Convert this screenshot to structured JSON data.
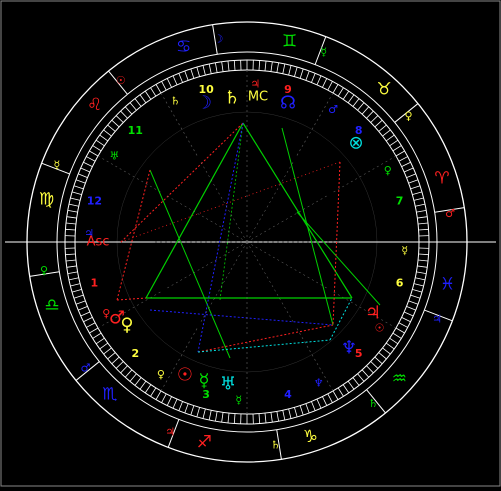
{
  "colors": {
    "background": "#000000",
    "frame": "#ffffff",
    "fire": "#ff2020",
    "earth": "#00e000",
    "air": "#ffff40",
    "water": "#2020ff",
    "aspect_trine": "#00d000",
    "aspect_square": "#ff2020",
    "aspect_sextile": "#2020ff",
    "aspect_quincunx": "#00e0e0",
    "house_number": "#ffff40"
  },
  "signs": [
    {
      "name": "Aries",
      "glyph": "♈",
      "ruler": "♂",
      "color": "#ff2020"
    },
    {
      "name": "Taurus",
      "glyph": "♉",
      "ruler": "♀",
      "color": "#ffff40"
    },
    {
      "name": "Gemini",
      "glyph": "♊",
      "ruler": "☿",
      "color": "#00e000"
    },
    {
      "name": "Cancer",
      "glyph": "♋",
      "ruler": "☽",
      "color": "#2020ff"
    },
    {
      "name": "Leo",
      "glyph": "♌",
      "ruler": "☉",
      "color": "#ff2020"
    },
    {
      "name": "Virgo",
      "glyph": "♍",
      "ruler": "☿",
      "color": "#ffff40"
    },
    {
      "name": "Libra",
      "glyph": "♎",
      "ruler": "♀",
      "color": "#00e000"
    },
    {
      "name": "Scorpio",
      "glyph": "♏",
      "ruler": "♂",
      "color": "#2020ff"
    },
    {
      "name": "Sagittarius",
      "glyph": "♐",
      "ruler": "♃",
      "color": "#ff2020"
    },
    {
      "name": "Capricorn",
      "glyph": "♑",
      "ruler": "♄",
      "color": "#ffff40"
    },
    {
      "name": "Aquarius",
      "glyph": "♒",
      "ruler": "♄",
      "color": "#00e000"
    },
    {
      "name": "Pisces",
      "glyph": "♓",
      "ruler": "♃",
      "color": "#2020ff"
    }
  ],
  "houses": [
    {
      "number": "1",
      "color": "#ff2020",
      "ruler": "♀"
    },
    {
      "number": "2",
      "color": "#ffff40",
      "ruler": "♀"
    },
    {
      "number": "3",
      "color": "#00e000",
      "ruler": "☿"
    },
    {
      "number": "4",
      "color": "#2020ff",
      "ruler": "♆"
    },
    {
      "number": "5",
      "color": "#ff2020",
      "ruler": "☉"
    },
    {
      "number": "6",
      "color": "#ffff40",
      "ruler": "☿"
    },
    {
      "number": "7",
      "color": "#00e000",
      "ruler": "♀"
    },
    {
      "number": "8",
      "color": "#2020ff",
      "ruler": "♂"
    },
    {
      "number": "9",
      "color": "#ff2020",
      "ruler": "♃"
    },
    {
      "number": "10",
      "color": "#ffff40",
      "ruler": "♄"
    },
    {
      "number": "11",
      "color": "#00e000",
      "ruler": "♅"
    },
    {
      "number": "12",
      "color": "#2020ff",
      "ruler": "♃"
    }
  ],
  "planets": [
    {
      "name": "Saturn",
      "glyph": "♄",
      "color": "#ffff40"
    },
    {
      "name": "Midheaven",
      "glyph": "MC",
      "color": "#ffff40"
    },
    {
      "name": "Node",
      "glyph": "☊",
      "color": "#2020ff"
    },
    {
      "name": "Moon",
      "glyph": "☽",
      "color": "#2020ff"
    },
    {
      "name": "Part of Fortune",
      "glyph": "⊗",
      "color": "#00e0e0"
    },
    {
      "name": "Ascendant",
      "glyph": "Asc",
      "color": "#ff2020"
    },
    {
      "name": "Mars",
      "glyph": "♂",
      "color": "#ff2020"
    },
    {
      "name": "Venus",
      "glyph": "♀",
      "color": "#ffff40"
    },
    {
      "name": "Sun",
      "glyph": "☉",
      "color": "#ff2020"
    },
    {
      "name": "Mercury",
      "glyph": "☿",
      "color": "#00e000"
    },
    {
      "name": "Uranus",
      "glyph": "♅",
      "color": "#00e0e0"
    },
    {
      "name": "Neptune",
      "glyph": "♆",
      "color": "#2020ff"
    },
    {
      "name": "Jupiter",
      "glyph": "♃",
      "color": "#ff2020"
    },
    {
      "name": "Pluto",
      "glyph": "♇",
      "color": "#ffff40"
    }
  ]
}
